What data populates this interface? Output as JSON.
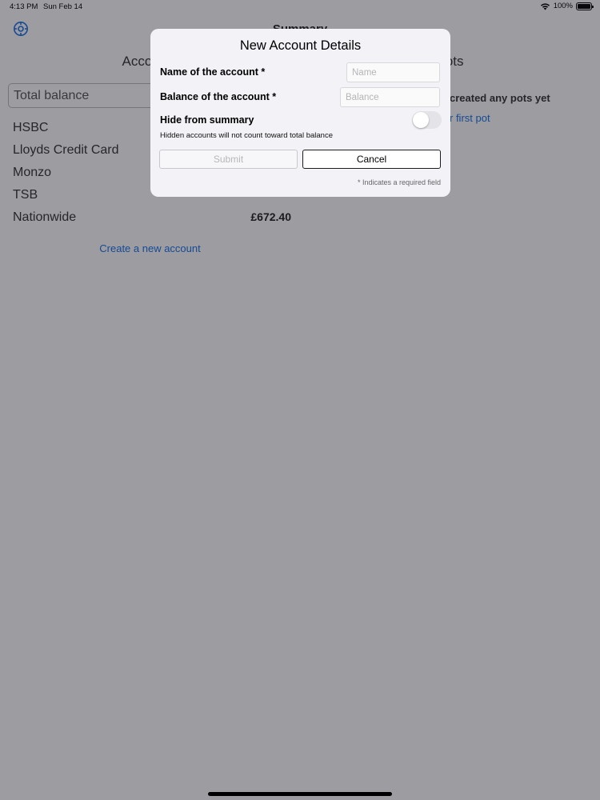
{
  "status_bar": {
    "time": "4:13 PM",
    "date": "Sun Feb 14",
    "battery": "100%"
  },
  "nav": {
    "title": "Summary",
    "settings_icon": "settings-icon"
  },
  "accounts_panel": {
    "heading": "Accounts",
    "total_balance_label": "Total balance",
    "accounts": [
      {
        "name": "HSBC",
        "balance": ""
      },
      {
        "name": "Lloyds Credit Card",
        "balance": ""
      },
      {
        "name": "Monzo",
        "balance": ""
      },
      {
        "name": "TSB",
        "balance": ""
      },
      {
        "name": "Nationwide",
        "balance": "£672.40"
      }
    ],
    "create_link": "Create a new account"
  },
  "pots_panel": {
    "heading": "Pots",
    "empty_message": "created any pots yet",
    "create_link": "r first pot"
  },
  "modal": {
    "title": "New Account Details",
    "name_label": "Name of the account *",
    "name_placeholder": "Name",
    "name_value": "",
    "balance_label": "Balance of the account *",
    "balance_placeholder": "Balance",
    "balance_value": "",
    "hide_label": "Hide from summary",
    "hide_helper": "Hidden accounts will not count toward total balance",
    "hide_enabled": false,
    "submit_label": "Submit",
    "cancel_label": "Cancel",
    "required_note": "* Indicates a required field"
  },
  "colors": {
    "accent": "#1a73e8",
    "modal_background": "#f2f2f7",
    "overlay": "rgba(20, 20, 30, 0.42)"
  }
}
